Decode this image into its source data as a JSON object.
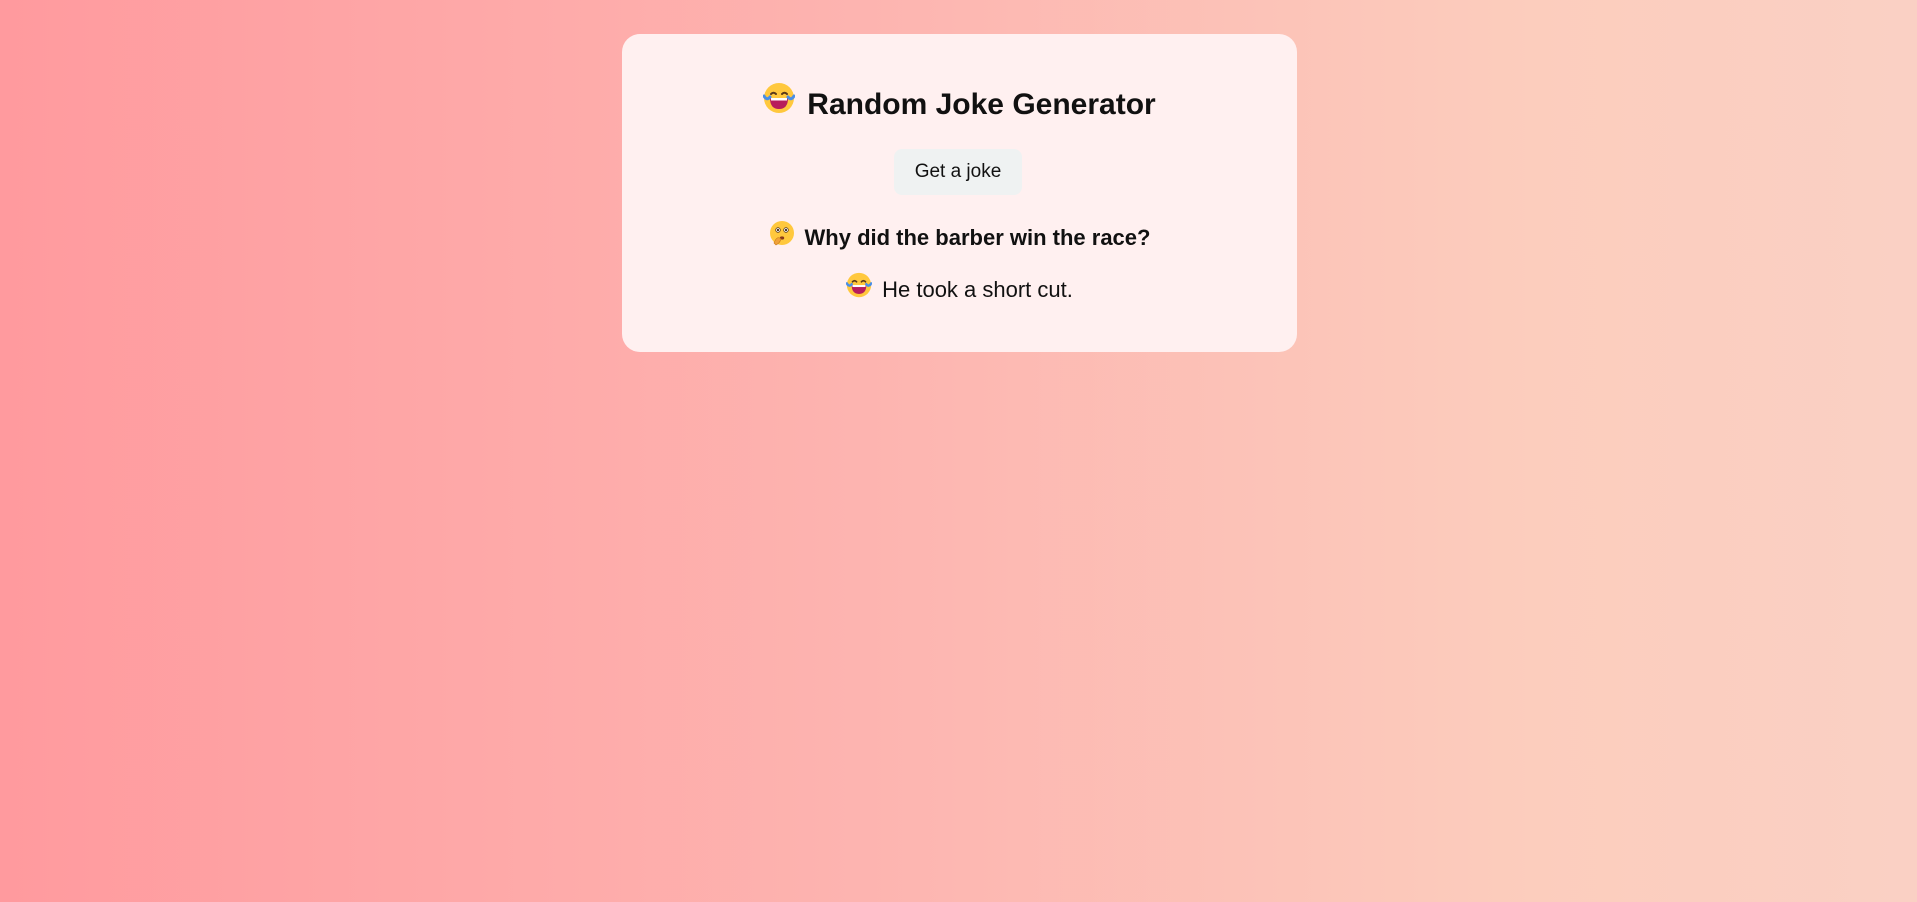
{
  "header": {
    "title": "Random Joke Generator",
    "title_icon": "laughing-tears-face-icon"
  },
  "controls": {
    "get_joke_label": "Get a joke"
  },
  "joke": {
    "setup": "Why did the barber win the race?",
    "setup_icon": "thinking-face-icon",
    "punchline": "He took a short cut.",
    "punchline_icon": "laughing-tears-face-icon"
  },
  "colors": {
    "background_start": "#ff9a9e",
    "background_end": "#fad0c4",
    "card": "#fff0f0",
    "button": "#eff2f2"
  }
}
